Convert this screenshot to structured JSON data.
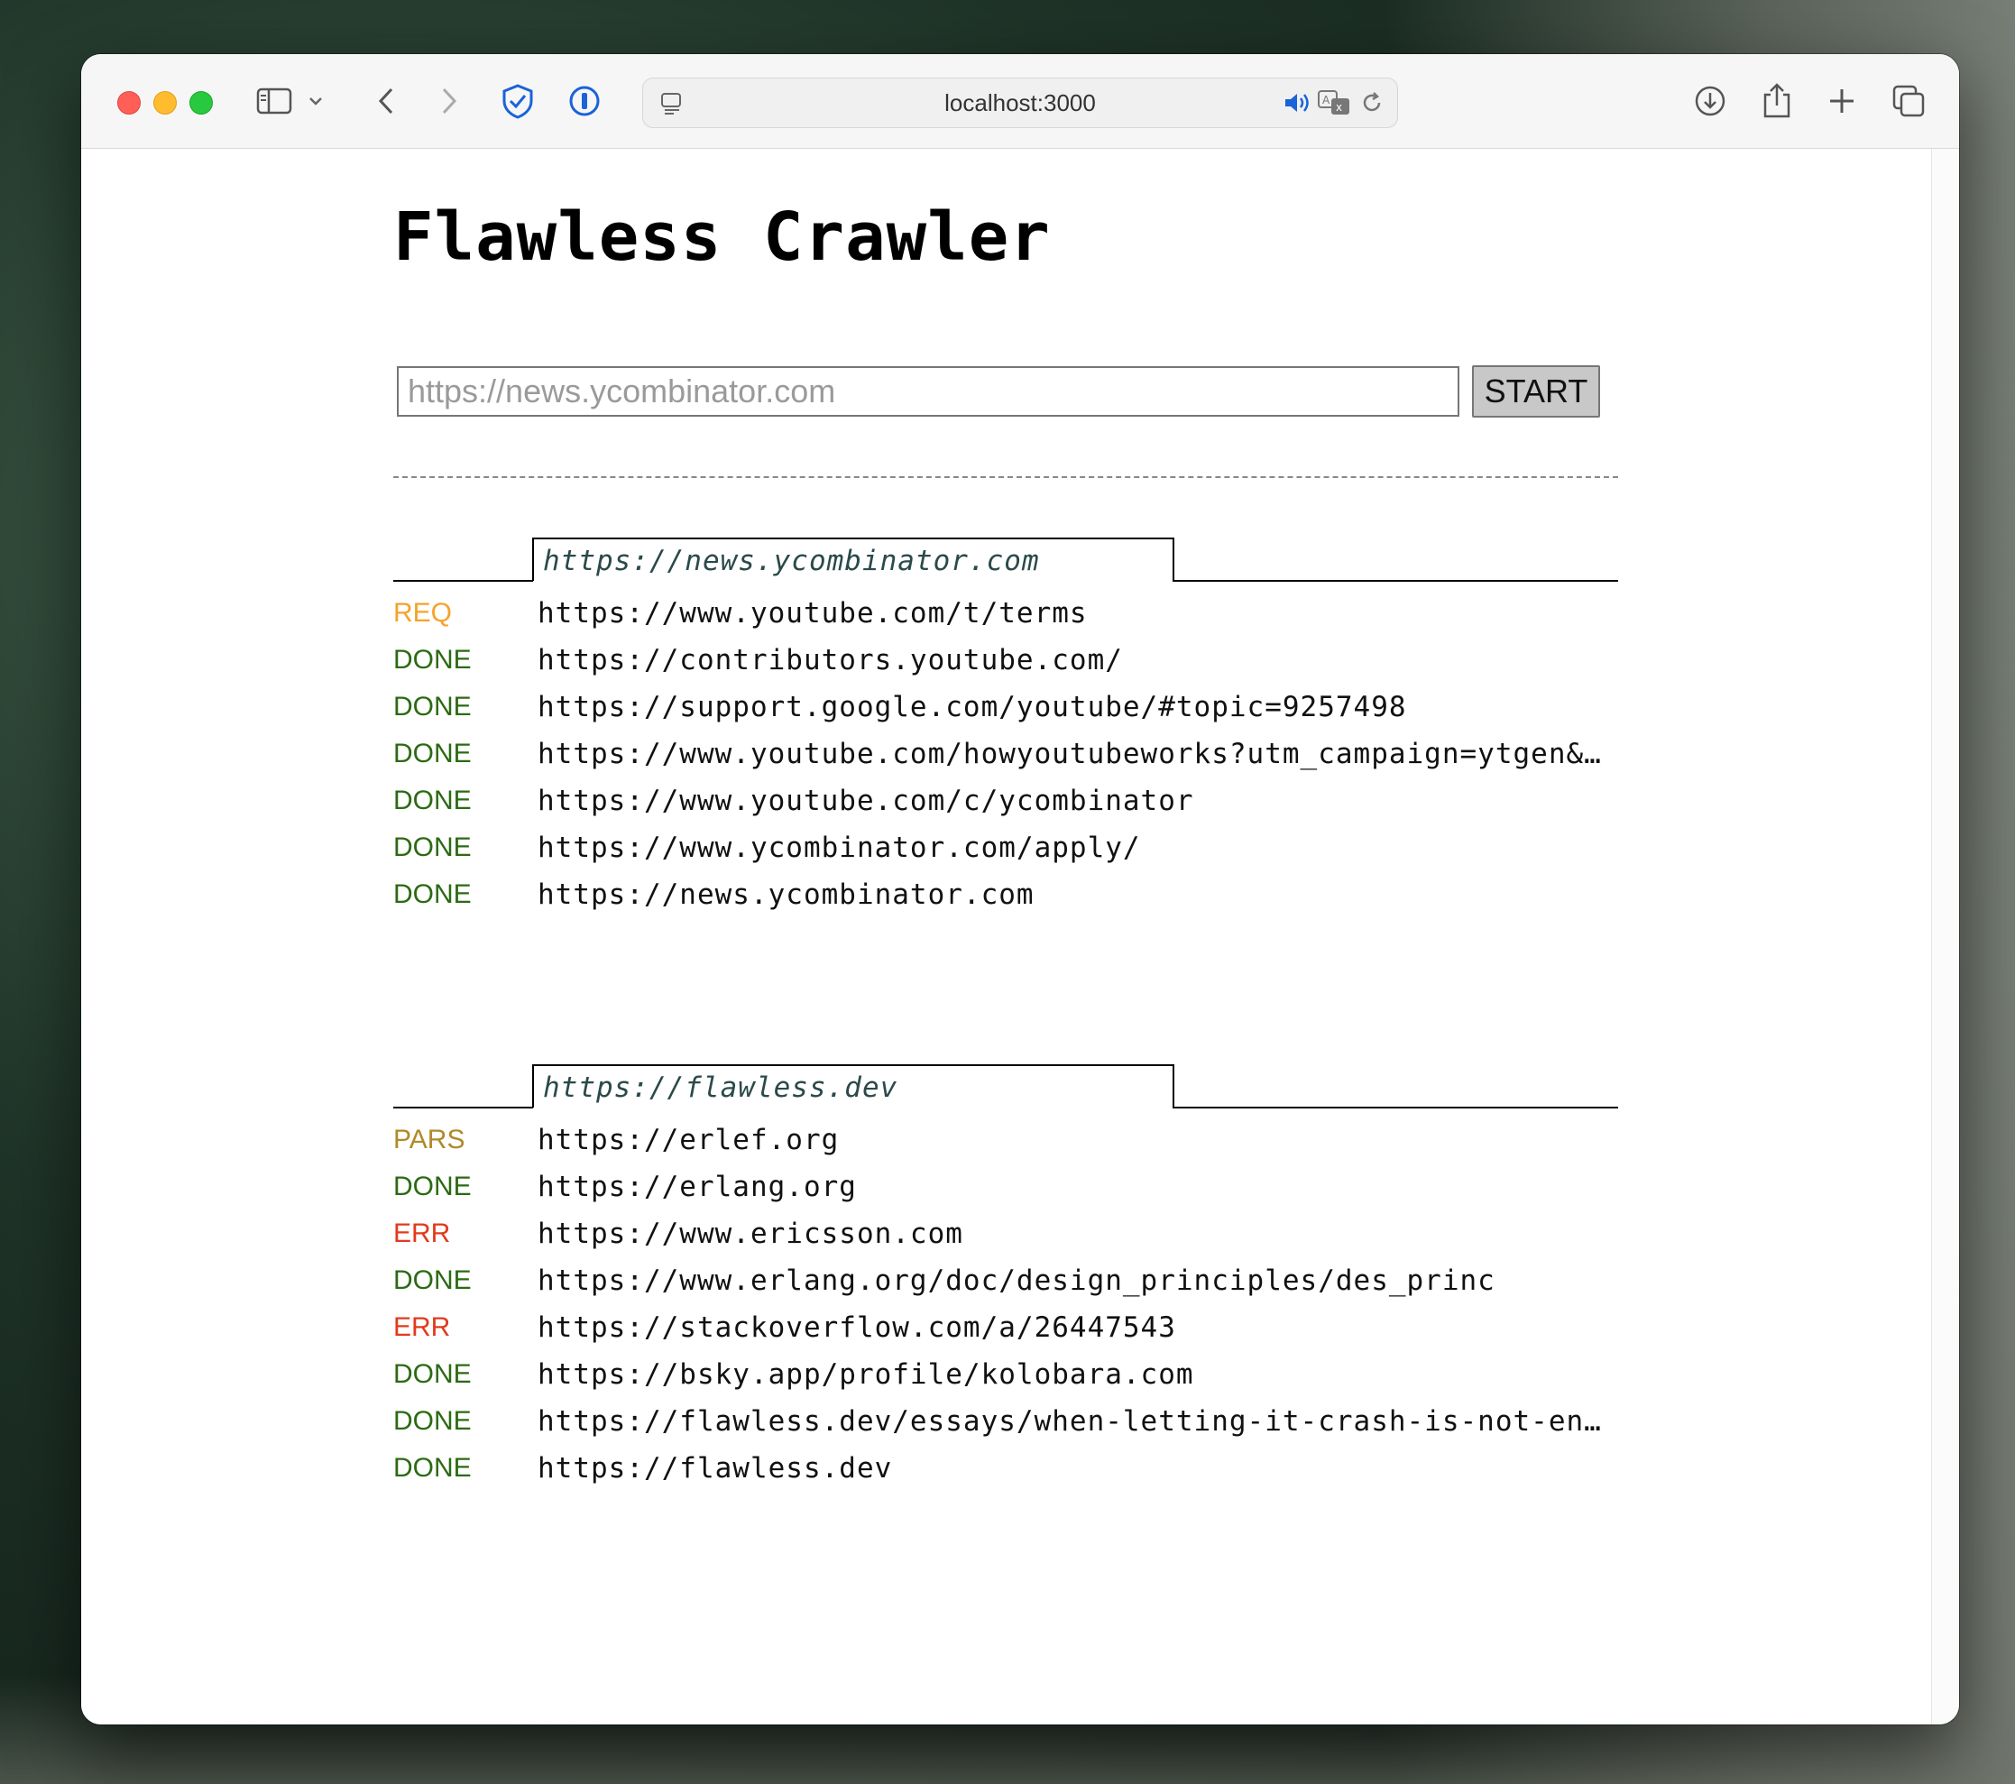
{
  "browser": {
    "address": "localhost:3000"
  },
  "page": {
    "title": "Flawless Crawler",
    "input_placeholder": "https://news.ycombinator.com",
    "start_label": "START"
  },
  "status_colors": {
    "REQ": "#f5a32a",
    "DONE": "#2b6a12",
    "PARS": "#b08a2a",
    "ERR": "#e23a1c"
  },
  "crawls": [
    {
      "root": "https://news.ycombinator.com",
      "rows": [
        {
          "status": "REQ",
          "url": "https://www.youtube.com/t/terms"
        },
        {
          "status": "DONE",
          "url": "https://contributors.youtube.com/"
        },
        {
          "status": "DONE",
          "url": "https://support.google.com/youtube/#topic=9257498"
        },
        {
          "status": "DONE",
          "url": "https://www.youtube.com/howyoutubeworks?utm_campaign=ytgen&…"
        },
        {
          "status": "DONE",
          "url": "https://www.youtube.com/c/ycombinator"
        },
        {
          "status": "DONE",
          "url": "https://www.ycombinator.com/apply/"
        },
        {
          "status": "DONE",
          "url": "https://news.ycombinator.com"
        }
      ]
    },
    {
      "root": "https://flawless.dev",
      "rows": [
        {
          "status": "PARS",
          "url": "https://erlef.org"
        },
        {
          "status": "DONE",
          "url": "https://erlang.org"
        },
        {
          "status": "ERR",
          "url": "https://www.ericsson.com"
        },
        {
          "status": "DONE",
          "url": "https://www.erlang.org/doc/design_principles/des_princ"
        },
        {
          "status": "ERR",
          "url": "https://stackoverflow.com/a/26447543"
        },
        {
          "status": "DONE",
          "url": "https://bsky.app/profile/kolobara.com"
        },
        {
          "status": "DONE",
          "url": "https://flawless.dev/essays/when-letting-it-crash-is-not-en…"
        },
        {
          "status": "DONE",
          "url": "https://flawless.dev"
        }
      ]
    }
  ]
}
